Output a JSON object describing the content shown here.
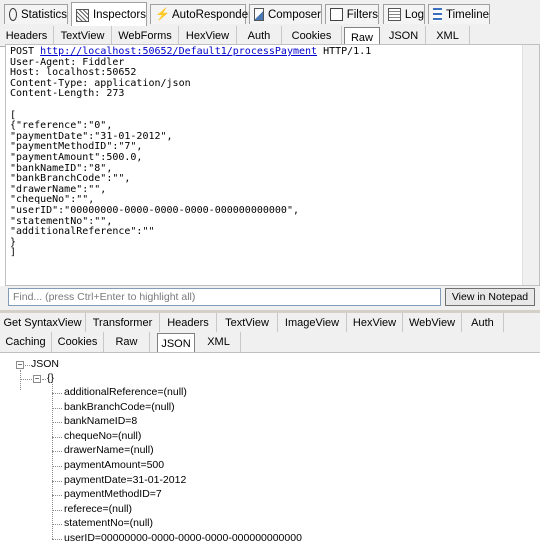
{
  "main_tabs": [
    {
      "label": "Statistics",
      "icon": "stopwatch-icon"
    },
    {
      "label": "Inspectors",
      "icon": "inspectors-icon",
      "active": true
    },
    {
      "label": "AutoResponder",
      "icon": "lightning-icon"
    },
    {
      "label": "Composer",
      "icon": "composer-icon"
    },
    {
      "label": "Filters",
      "icon": "checkbox-icon"
    },
    {
      "label": "Log",
      "icon": "log-icon"
    },
    {
      "label": "Timeline",
      "icon": "timeline-icon"
    }
  ],
  "request_tabs": [
    "Headers",
    "TextView",
    "WebForms",
    "HexView",
    "Auth",
    "Cookies",
    "Raw",
    "JSON",
    "XML"
  ],
  "request_active_tab": "Raw",
  "request": {
    "method": "POST ",
    "url": "http://localhost:50652/Default1/processPayment",
    "protocol": " HTTP/1.1",
    "lines": [
      "User-Agent: Fiddler",
      "Host: localhost:50652",
      "Content-Type: application/json",
      "Content-Length: 273",
      "",
      "[",
      "{\"reference\":\"0\",",
      "\"paymentDate\":\"31-01-2012\",",
      "\"paymentMethodID\":\"7\",",
      "\"paymentAmount\":500.0,",
      "\"bankNameID\":\"8\",",
      "\"bankBranchCode\":\"\",",
      "\"drawerName\":\"\",",
      "\"chequeNo\":\"\",",
      "\"userID\":\"00000000-0000-0000-0000-000000000000\",",
      "\"statementNo\":\"\",",
      "\"additionalReference\":\"\"",
      "}",
      "]"
    ]
  },
  "find": {
    "placeholder": "Find... (press Ctrl+Enter to highlight all)",
    "button": "View in Notepad"
  },
  "response_tabs_row1": [
    "Get SyntaxView",
    "Transformer",
    "Headers",
    "TextView",
    "ImageView",
    "HexView",
    "WebView",
    "Auth"
  ],
  "response_tabs_row2": [
    "Caching",
    "Cookies",
    "Raw",
    "JSON",
    "XML"
  ],
  "response_active_tab": "JSON",
  "tree": {
    "root": "JSON",
    "object": "{}",
    "items": [
      "additionalReference=(null)",
      "bankBranchCode=(null)",
      "bankNameID=8",
      "chequeNo=(null)",
      "drawerName=(null)",
      "paymentAmount=500",
      "paymentDate=31-01-2012",
      "paymentMethodID=7",
      "referece=(null)",
      "statementNo=(null)",
      "userID=00000000-0000-0000-0000-000000000000"
    ]
  },
  "colors": {
    "link": "#0000cc",
    "chrome": "#f0f0f0"
  }
}
